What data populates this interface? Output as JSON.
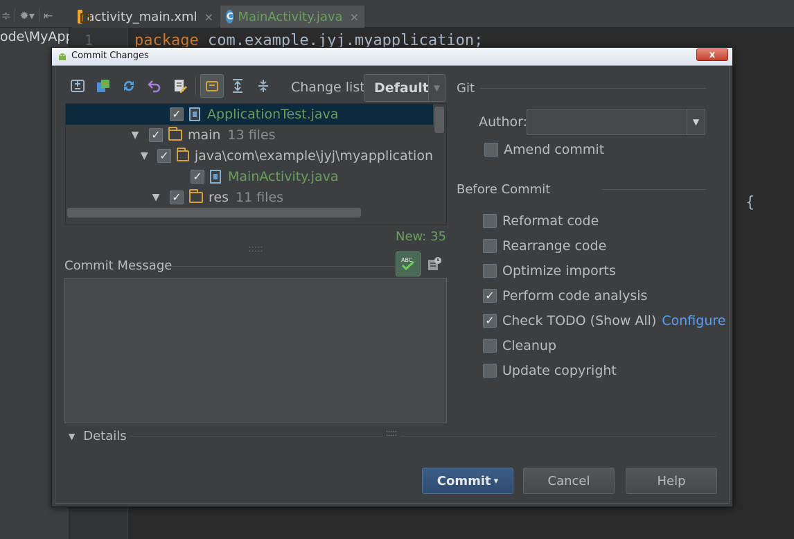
{
  "ide": {
    "tabs": [
      {
        "label": "activity_main.xml",
        "close": "×",
        "icon": "xml-file-icon"
      },
      {
        "label": "MainActivity.java",
        "close": "×",
        "icon": "java-class-icon"
      }
    ],
    "project_path": "ode\\MyApp",
    "line_number": "1",
    "code_keyword": "package",
    "code_rest": " com.example.jyj.myapplication;",
    "brace": "{"
  },
  "dialog": {
    "title": "Commit Changes",
    "close_symbol": "x",
    "toolbar": {
      "icons": [
        "diff-icon",
        "move-to-changelist-icon",
        "refresh-icon",
        "revert-icon",
        "edit-source-icon",
        "group-by-directory-icon",
        "expand-all-icon",
        "collapse-all-icon"
      ],
      "changelist_label": "Change list:",
      "changelist_value": "Default"
    },
    "tree": {
      "rows": [
        {
          "name": "ApplicationTest.java",
          "count": "",
          "type": "file",
          "checked": true,
          "expanded": null,
          "selected": true
        },
        {
          "name": "main",
          "count": "13 files",
          "type": "folder",
          "checked": true,
          "expanded": true,
          "selected": false
        },
        {
          "name": "java\\com\\example\\jyj\\myapplication",
          "count": "",
          "type": "folder",
          "checked": true,
          "expanded": true,
          "selected": false
        },
        {
          "name": "MainActivity.java",
          "count": "",
          "type": "file",
          "checked": true,
          "expanded": null,
          "selected": false
        },
        {
          "name": "res",
          "count": "11 files",
          "type": "folder",
          "checked": true,
          "expanded": true,
          "selected": false
        }
      ],
      "new_count": "New: 35"
    },
    "commit_message": {
      "label": "Commit Message",
      "value": ""
    },
    "git": {
      "label": "Git",
      "author_label": "Author:",
      "author_value": "",
      "amend_label": "Amend commit",
      "amend_checked": false
    },
    "before_commit": {
      "label": "Before Commit",
      "options": [
        {
          "label": "Reformat code",
          "checked": false
        },
        {
          "label": "Rearrange code",
          "checked": false
        },
        {
          "label": "Optimize imports",
          "checked": false
        },
        {
          "label": "Perform code analysis",
          "checked": true
        },
        {
          "label": "Check TODO (Show All)",
          "checked": true,
          "link": "Configure"
        },
        {
          "label": "Cleanup",
          "checked": false
        },
        {
          "label": "Update copyright",
          "checked": false
        }
      ]
    },
    "details_label": "Details",
    "buttons": {
      "commit": "Commit",
      "commit_arrow": "▾",
      "cancel": "Cancel",
      "help": "Help"
    },
    "colors": {
      "accent_blue": "#3b5d87",
      "selection": "#0d293e",
      "new_file_green": "#6a9f5a",
      "link": "#589df6"
    }
  }
}
